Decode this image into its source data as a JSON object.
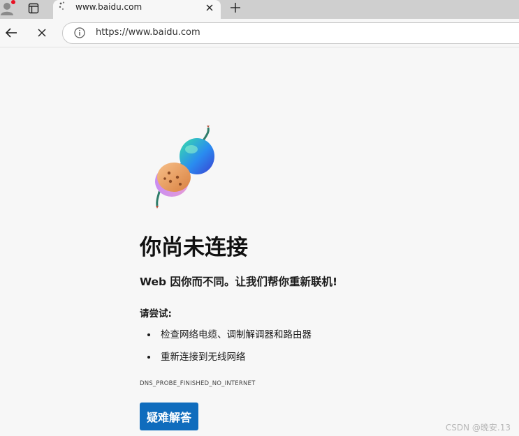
{
  "tab": {
    "title": "www.baidu.com"
  },
  "omnibox": {
    "url": "https://www.baidu.com"
  },
  "error_page": {
    "heading": "你尚未连接",
    "subtitle": "Web 因你而不同。让我们帮你重新联机!",
    "try_label": "请尝试:",
    "suggestions": [
      "检查网络电缆、调制解调器和路由器",
      "重新连接到无线网络"
    ],
    "error_code": "DNS_PROBE_FINISHED_NO_INTERNET",
    "faq_button_label": "疑难解答"
  },
  "watermark": "CSDN @晚安.13",
  "icons": {
    "profile": "profile-avatar-icon",
    "tab_actions": "tab-actions-menu-icon",
    "tab_loading": "loading-spinner-icon",
    "tab_close": "close-icon",
    "new_tab": "plus-icon",
    "back": "back-arrow-icon",
    "stop": "stop-loading-icon",
    "site_info": "info-icon"
  },
  "colors": {
    "accent": "#0f6cbd",
    "page_background": "#f7f7f7",
    "tabstrip": "#cfcfcf",
    "notification_dot": "#e81123"
  }
}
